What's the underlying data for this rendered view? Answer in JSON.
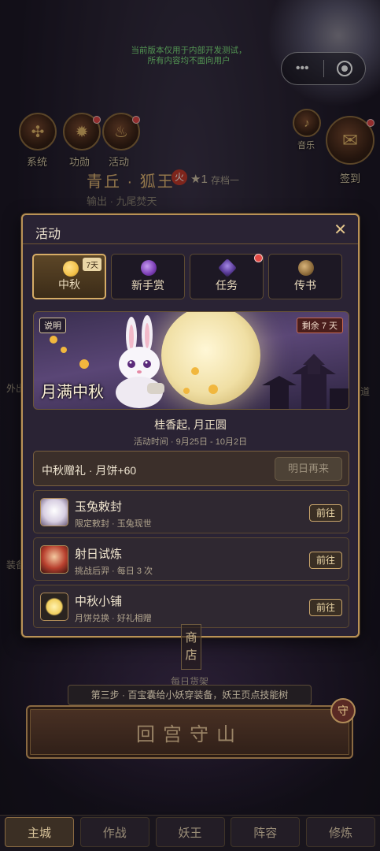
{
  "notice": {
    "line1": "当前版本仅用于内部开发测试，",
    "line2": "所有内容均不面向用户"
  },
  "capsule": {
    "menu_icon": "more-dots-icon",
    "close_icon": "target-ring-icon"
  },
  "top_icons": [
    {
      "label": "系统",
      "icon": "compass-icon"
    },
    {
      "label": "功勋",
      "icon": "medal-icon",
      "badge": true
    },
    {
      "label": "活动",
      "icon": "flame-icon",
      "badge": true
    }
  ],
  "right_icons": [
    {
      "label": "音乐",
      "icon": "music-icon"
    },
    {
      "label": "签到",
      "icon": "scroll-icon",
      "badge": true
    }
  ],
  "hero": {
    "name": "青丘 · 狐王",
    "element": "火",
    "stars": "★1",
    "save_slot": "存档一",
    "subtitle": "输出 · 九尾焚天"
  },
  "side_texts": {
    "left_1": "外出",
    "left_2": "装备",
    "right_1": "道"
  },
  "modal": {
    "title": "活动",
    "close": "✕",
    "tabs": [
      {
        "label": "中秋",
        "days": "7天",
        "active": true,
        "icon": "mooncake-icon",
        "icon_color": "#f2c14a"
      },
      {
        "label": "新手赏",
        "active": false,
        "icon": "purple-orb-icon",
        "icon_color": "#7a3cb4"
      },
      {
        "label": "任务",
        "active": false,
        "icon": "purple-crystal-icon",
        "icon_color": "#5b3c9a",
        "badge": true
      },
      {
        "label": "传书",
        "active": false,
        "icon": "bronze-scroll-icon",
        "icon_color": "#8c6a3a"
      }
    ],
    "banner": {
      "tag_left": "说明",
      "tag_right": "剩余 7 天",
      "title": "月满中秋"
    },
    "subtitle": "桂香起, 月正圆",
    "period": "活动时间 · 9月25日 - 10月2日",
    "gift": {
      "text": "中秋赠礼 · 月饼+60",
      "button": "明日再来"
    },
    "activities": [
      {
        "name": "玉兔敕封",
        "desc": "限定敕封 · 玉兔现世",
        "button": "前往",
        "icon": "jade-rabbit-icon"
      },
      {
        "name": "射日试炼",
        "desc": "挑战后羿 · 每日 3 次",
        "button": "前往",
        "icon": "archer-icon"
      },
      {
        "name": "中秋小铺",
        "desc": "月饼兑换 · 好礼相赠",
        "button": "前往",
        "icon": "mooncake-icon"
      }
    ]
  },
  "shop": {
    "c1": "商",
    "c2": "店",
    "label": "每日货架"
  },
  "step_tip": "第三步 · 百宝囊给小妖穿装备，妖王页点技能树",
  "main_button": "回宫守山",
  "seal": "守",
  "nav": [
    {
      "label": "主城",
      "active": true
    },
    {
      "label": "作战",
      "active": false
    },
    {
      "label": "妖王",
      "active": false
    },
    {
      "label": "阵容",
      "active": false
    },
    {
      "label": "修炼",
      "active": false
    }
  ]
}
